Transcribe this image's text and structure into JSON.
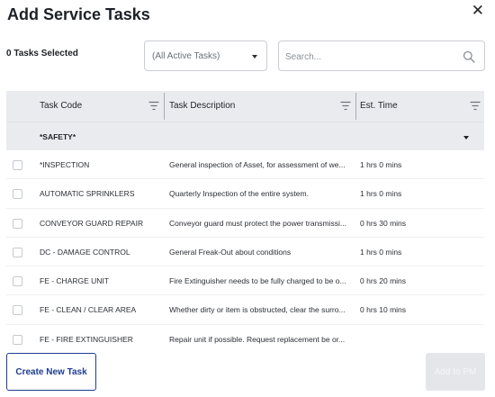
{
  "dialog": {
    "title": "Add Service Tasks",
    "close_glyph": "✕"
  },
  "toolbar": {
    "selected_count": "0 Tasks Selected",
    "filter_value": "(All Active Tasks)",
    "search_placeholder": "Search..."
  },
  "table": {
    "columns": [
      "Task Code",
      "Task Description",
      "Est. Time"
    ],
    "group_label": "*SAFETY*",
    "rows": [
      {
        "code": "*INSPECTION",
        "description": "General inspection of Asset, for assessment of we...",
        "time": "1 hrs 0 mins"
      },
      {
        "code": "AUTOMATIC SPRINKLERS",
        "description": "Quarterly Inspection of the entire system.",
        "time": "1 hrs 0 mins"
      },
      {
        "code": "CONVEYOR GUARD REPAIR",
        "description": "Conveyor guard must protect the power transmissi...",
        "time": "0 hrs 30 mins"
      },
      {
        "code": "DC - DAMAGE CONTROL",
        "description": "General Freak-Out about conditions",
        "time": "1 hrs 0 mins"
      },
      {
        "code": "FE - CHARGE UNIT",
        "description": "Fire Extinguisher needs to be fully charged to be o...",
        "time": "0 hrs 20 mins"
      },
      {
        "code": "FE - CLEAN / CLEAR AREA",
        "description": "Whether dirty or item is obstructed, clear the surro...",
        "time": "0 hrs 10 mins"
      },
      {
        "code": "FE - FIRE EXTINGUISHER",
        "description": "Repair unit if possible. Request replacement be or...",
        "time": ""
      }
    ]
  },
  "footer": {
    "create_label": "Create New Task",
    "add_label": "Add to PM"
  },
  "colors": {
    "accent": "#1f3c8f",
    "header_bg": "#e9ebef",
    "disabled_bg": "#e4e6ea"
  },
  "icons": [
    "close-icon",
    "chevron-down-icon",
    "search-icon",
    "filter-icon",
    "checkbox-icon"
  ]
}
